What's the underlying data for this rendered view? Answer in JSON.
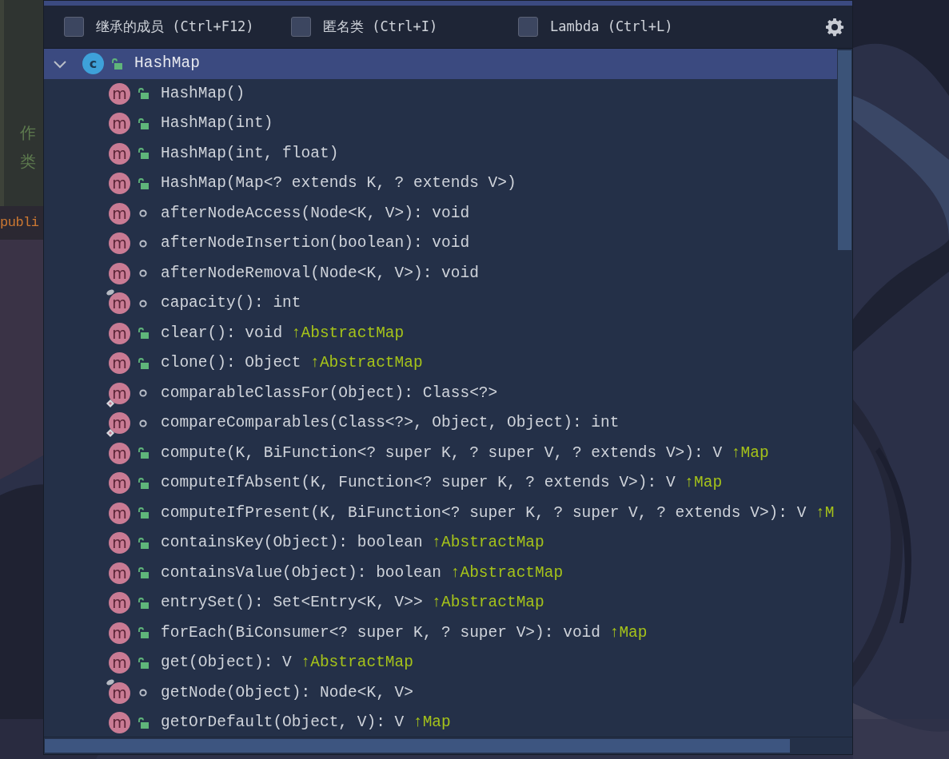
{
  "editor": {
    "doc_lines": [
      {
        "text": "作"
      },
      {
        "text": "类"
      }
    ],
    "code_lines": [
      {
        "text": "publi"
      }
    ]
  },
  "popup": {
    "options": [
      {
        "label": "继承的成员 (Ctrl+F12)",
        "checked": false
      },
      {
        "label": "匿名类 (Ctrl+I)",
        "checked": false
      },
      {
        "label": "Lambda (Ctrl+L)",
        "checked": false
      }
    ],
    "tree": [
      {
        "label": "HashMap",
        "icon_letter": "c",
        "kind": "class",
        "public": true,
        "expanded": true,
        "selected": true,
        "children": [
          {
            "label": "HashMap()",
            "icon_letter": "m",
            "kind": "method",
            "public": true,
            "selected": false
          },
          {
            "label": "HashMap(int)",
            "icon_letter": "m",
            "kind": "method",
            "public": true,
            "selected": false
          },
          {
            "label": "HashMap(int, float)",
            "icon_letter": "m",
            "kind": "method",
            "public": true,
            "selected": false
          },
          {
            "label": "HashMap(Map<? extends K, ? extends V>)",
            "icon_letter": "m",
            "kind": "method",
            "public": true,
            "selected": false
          },
          {
            "label": "afterNodeAccess(Node<K, V>): void",
            "icon_letter": "m",
            "kind": "method",
            "public": false,
            "selected": false
          },
          {
            "label": "afterNodeInsertion(boolean): void",
            "icon_letter": "m",
            "kind": "method",
            "public": false,
            "selected": false
          },
          {
            "label": "afterNodeRemoval(Node<K, V>): void",
            "icon_letter": "m",
            "kind": "method",
            "public": false,
            "selected": false
          },
          {
            "label": "capacity(): int",
            "icon_letter": "m",
            "kind": "method",
            "public": false,
            "pinned": true,
            "selected": false
          },
          {
            "label": "clear(): void",
            "origin": "↑AbstractMap",
            "icon_letter": "m",
            "kind": "method",
            "public": true,
            "selected": false
          },
          {
            "label": "clone(): Object",
            "origin": "↑AbstractMap",
            "icon_letter": "m",
            "kind": "method",
            "public": true,
            "selected": false
          },
          {
            "label": "comparableClassFor(Object): Class<?>",
            "icon_letter": "m",
            "kind": "method",
            "public": false,
            "static": true,
            "selected": false
          },
          {
            "label": "compareComparables(Class<?>, Object, Object): int",
            "icon_letter": "m",
            "kind": "method",
            "public": false,
            "static": true,
            "selected": false
          },
          {
            "label": "compute(K, BiFunction<? super K, ? super V, ? extends V>): V",
            "origin": "↑Map",
            "icon_letter": "m",
            "kind": "method",
            "public": true,
            "selected": false
          },
          {
            "label": "computeIfAbsent(K, Function<? super K, ? extends V>): V",
            "origin": "↑Map",
            "icon_letter": "m",
            "kind": "method",
            "public": true,
            "selected": false
          },
          {
            "label": "computeIfPresent(K, BiFunction<? super K, ? super V, ? extends V>): V",
            "origin": "↑M",
            "icon_letter": "m",
            "kind": "method",
            "public": true,
            "selected": false
          },
          {
            "label": "containsKey(Object): boolean",
            "origin": "↑AbstractMap",
            "icon_letter": "m",
            "kind": "method",
            "public": true,
            "selected": false
          },
          {
            "label": "containsValue(Object): boolean",
            "origin": "↑AbstractMap",
            "icon_letter": "m",
            "kind": "method",
            "public": true,
            "selected": false
          },
          {
            "label": "entrySet(): Set<Entry<K, V>>",
            "origin": "↑AbstractMap",
            "icon_letter": "m",
            "kind": "method",
            "public": true,
            "selected": false
          },
          {
            "label": "forEach(BiConsumer<? super K, ? super V>): void",
            "origin": "↑Map",
            "icon_letter": "m",
            "kind": "method",
            "public": true,
            "selected": false
          },
          {
            "label": "get(Object): V",
            "origin": "↑AbstractMap",
            "icon_letter": "m",
            "kind": "method",
            "public": true,
            "selected": false
          },
          {
            "label": "getNode(Object): Node<K, V>",
            "icon_letter": "m",
            "kind": "method",
            "public": false,
            "pinned": true,
            "selected": false
          },
          {
            "label": "getOrDefault(Object, V): V",
            "origin": "↑Map",
            "icon_letter": "m",
            "kind": "method",
            "public": true,
            "selected": false
          }
        ]
      }
    ]
  }
}
